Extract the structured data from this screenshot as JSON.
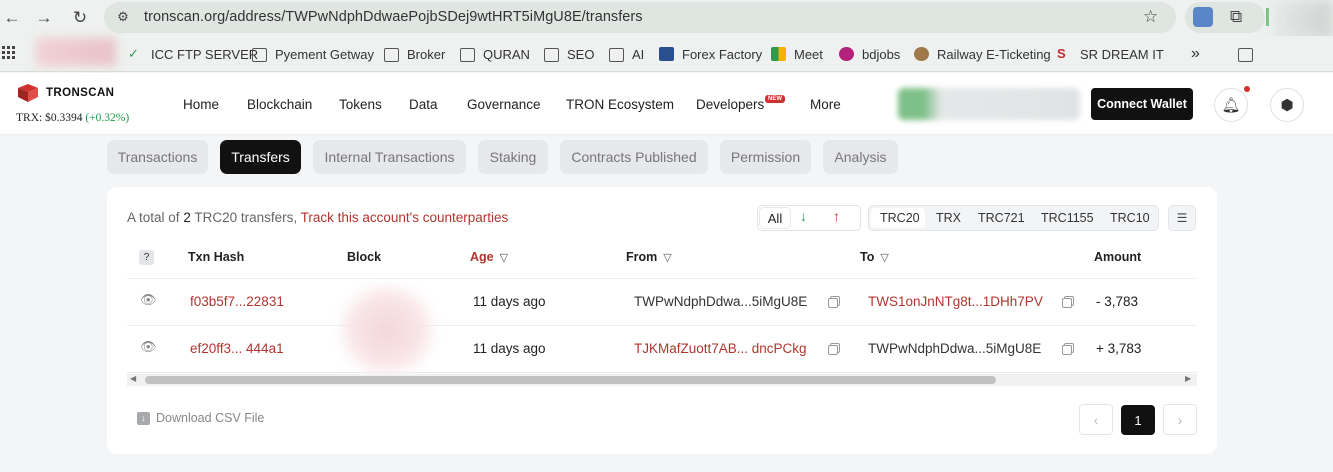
{
  "browser": {
    "url": "tronscan.org/address/TWPwNdphDdwaePojbSDej9wtHRT5iMgU8E/transfers",
    "bookmarks": [
      "ICC FTP SERVER",
      "Pyement Getway",
      "Broker",
      "QURAN",
      "SEO",
      "AI",
      "Forex Factory",
      "Meet",
      "bdjobs",
      "Railway E-Ticketing",
      "SR DREAM IT"
    ],
    "more_bookmarks": "»"
  },
  "header": {
    "logo": "TRONSCAN",
    "price_label": "TRX:",
    "price": "$0.3394",
    "change": "(+0.32%)",
    "nav": [
      "Home",
      "Blockchain",
      "Tokens",
      "Data",
      "Governance",
      "TRON Ecosystem",
      "Developers",
      "More"
    ],
    "new_badge": "NEW",
    "connect_wallet": "Connect Wallet"
  },
  "tabs": [
    "Transactions",
    "Transfers",
    "Internal Transactions",
    "Staking",
    "Contracts Published",
    "Permission",
    "Analysis"
  ],
  "active_tab": "Transfers",
  "summary": {
    "prefix": "A total of",
    "count": "2",
    "suffix": "TRC20 transfers,",
    "track_link": "Track this account's counterparties"
  },
  "direction_filter": {
    "all": "All",
    "in_icon": "arrow-down-icon",
    "out_icon": "arrow-up-icon"
  },
  "token_filters": [
    "TRC20",
    "TRX",
    "TRC721",
    "TRC1155",
    "TRC10"
  ],
  "selected_token": "TRC20",
  "table": {
    "help": "?",
    "columns": [
      "Txn Hash",
      "Block",
      "Age",
      "From",
      "To",
      "Amount"
    ],
    "rows": [
      {
        "hash": "f03b5f7...22831",
        "age": "11 days ago",
        "from": "TWPwNdphDdwa...5iMgU8E",
        "to": "TWS1onJnNTg8t...1DHh7PV",
        "amount": "- 3,783"
      },
      {
        "hash": "ef20ff3... 444a1",
        "age": "11 days ago",
        "from": "TJKMafZuott7AB... dncPCkg",
        "to": "TWPwNdphDdwa...5iMgU8E",
        "amount": "+ 3,783"
      }
    ]
  },
  "footer": {
    "download": "Download CSV File",
    "page": "1",
    "prev": "‹",
    "next": "›"
  },
  "colors": {
    "accent": "#b0352e",
    "dark": "#111111",
    "positive": "#1d9a4a"
  }
}
